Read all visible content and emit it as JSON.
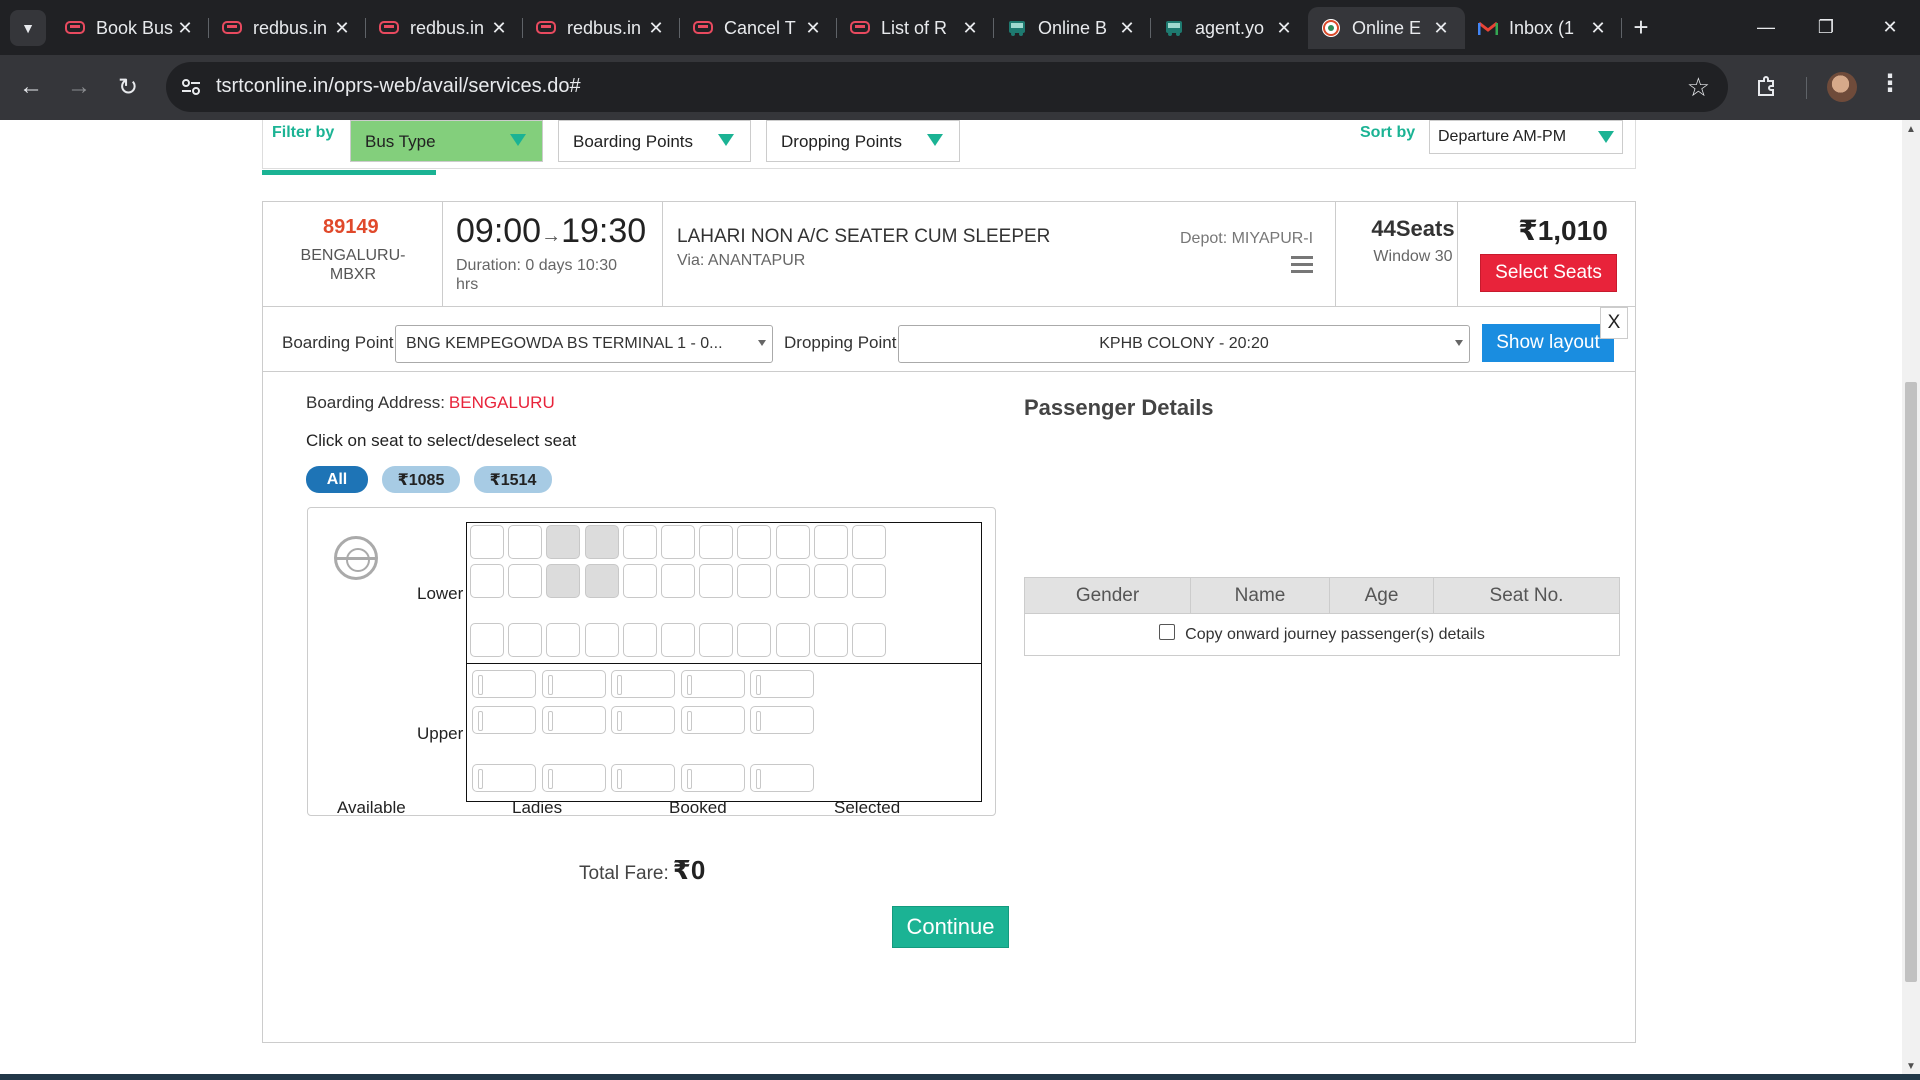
{
  "browser": {
    "tabs": [
      {
        "title": "Book Bus",
        "icon": "redbus-icon",
        "active": false
      },
      {
        "title": "redbus.in",
        "icon": "redbus-icon",
        "active": false
      },
      {
        "title": "redbus.in",
        "icon": "redbus-icon",
        "active": false
      },
      {
        "title": "redbus.in",
        "icon": "redbus-icon",
        "active": false
      },
      {
        "title": "Cancel T",
        "icon": "redbus-icon",
        "active": false
      },
      {
        "title": "List of R",
        "icon": "redbus-icon",
        "active": false
      },
      {
        "title": "Online B",
        "icon": "bus-agent-icon",
        "active": false
      },
      {
        "title": "agent.yo",
        "icon": "bus-agent-icon",
        "active": false
      },
      {
        "title": "Online E",
        "icon": "tsrtc-icon",
        "active": true
      },
      {
        "title": "Inbox (1",
        "icon": "gmail-icon",
        "active": false
      }
    ],
    "url": "tsrtconline.in/oprs-web/avail/services.do#"
  },
  "filters": {
    "filter_by_label": "Filter by",
    "bus_type": "Bus Type",
    "boarding_points": "Boarding Points",
    "dropping_points": "Dropping Points",
    "sort_by_label": "Sort by",
    "sort_value": "Departure AM-PM"
  },
  "service": {
    "number": "89149",
    "route_code_1": "BENGALURU-",
    "route_code_2": "MBXR",
    "departure": "09:00",
    "arrow": "→",
    "arrival": "19:30",
    "duration_1": "Duration: 0 days 10:30",
    "duration_2": "hrs",
    "bus_type": "LAHARI NON A/C SEATER CUM SLEEPER",
    "via": "Via: ANANTAPUR",
    "depot": "Depot: MIYAPUR-I",
    "seats": "44Seats",
    "window": "Window 30",
    "fare": "₹1,010",
    "select_seats": "Select Seats"
  },
  "booking": {
    "boarding_point_label": "Boarding Point",
    "boarding_point_value": "BNG KEMPEGOWDA BS TERMINAL 1 - 0...",
    "dropping_point_label": "Dropping Point",
    "dropping_point_value": "KPHB COLONY - 20:20",
    "show_layout": "Show layout",
    "boarding_address_label": "Boarding Address:",
    "boarding_address_value": "BENGALURU",
    "seat_hint": "Click on seat to select/deselect seat",
    "fare_filters": [
      "All",
      "₹1085",
      "₹1514"
    ],
    "lower_label": "Lower",
    "upper_label": "Upper",
    "legend": [
      "Available",
      "Ladies",
      "Booked",
      "Selected"
    ],
    "total_fare_label": "Total Fare:",
    "total_fare_value": "₹0",
    "continue": "Continue"
  },
  "passenger": {
    "title": "Passenger Details",
    "close": "X",
    "columns": [
      "Gender",
      "Name",
      "Age",
      "Seat No."
    ],
    "copy_label": "Copy onward journey passenger(s) details"
  },
  "colors": {
    "accent_green": "#1bb394",
    "danger_red": "#e8233a",
    "primary_blue": "#1a8de0"
  }
}
